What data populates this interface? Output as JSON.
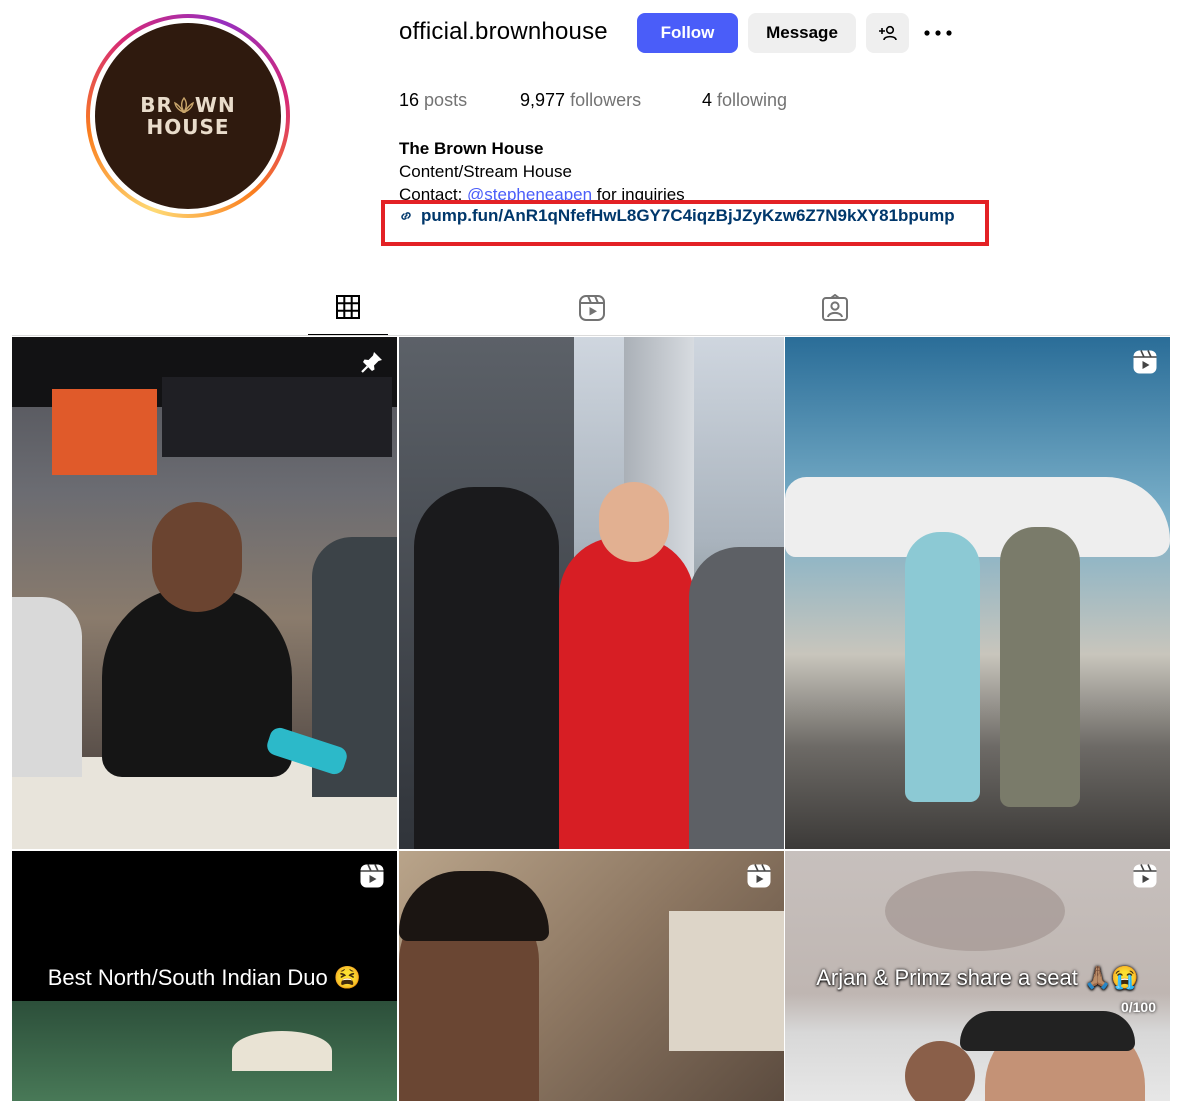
{
  "profile": {
    "username": "official.brownhouse",
    "logo_line1": "BR WN",
    "logo_line2": "HOUSE",
    "buttons": {
      "follow": "Follow",
      "message": "Message"
    },
    "stats": {
      "posts_count": "16",
      "posts_label": "posts",
      "followers_count": "9,977",
      "followers_label": "followers",
      "following_count": "4",
      "following_label": "following"
    },
    "bio": {
      "name": "The Brown House",
      "category": "Content/Stream House",
      "contact_prefix": "Contact: ",
      "contact_mention": "@stepheneapen",
      "contact_suffix": " for inquiries",
      "link": "pump.fun/AnR1qNfefHwL8GY7C4iqzBjJZyKzw6Z7N9kXY81bpump"
    }
  },
  "tabs": [
    {
      "icon": "grid-icon",
      "active": true
    },
    {
      "icon": "reels-icon",
      "active": false
    },
    {
      "icon": "tagged-icon",
      "active": false
    }
  ],
  "posts": [
    {
      "type": "pinned",
      "icon": "pin-icon",
      "caption": ""
    },
    {
      "type": "photo",
      "icon": "",
      "caption": ""
    },
    {
      "type": "reel",
      "icon": "reels-icon",
      "caption": ""
    },
    {
      "type": "reel",
      "icon": "reels-icon",
      "caption": "Best North/South Indian Duo 😫"
    },
    {
      "type": "reel",
      "icon": "reels-icon",
      "caption": ""
    },
    {
      "type": "reel",
      "icon": "reels-icon",
      "caption": "Arjan & Primz share a seat 🙏🏽😭",
      "counter": "0/100"
    }
  ],
  "colors": {
    "follow_button": "#4a5df9",
    "link": "#00376b",
    "mention": "#4a5df9",
    "highlight_box": "#e32125"
  }
}
